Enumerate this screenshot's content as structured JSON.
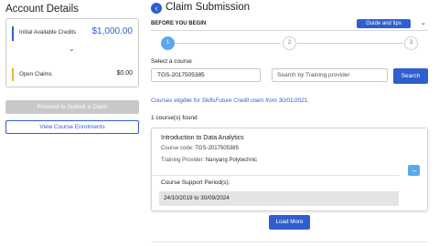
{
  "sidebar": {
    "title": "Account Details",
    "credits": {
      "label": "Initial Available Credits",
      "value": "$1,000.00"
    },
    "claims": {
      "label": "Open Claims",
      "value": "$0.00"
    },
    "proceed_label": "Proceed to Submit a Claim",
    "view_enrolments_label": "View Course Enrolments"
  },
  "header": {
    "back_icon": "chevron-left-icon",
    "title": "Claim Submission",
    "section_label": "BEFORE YOU BEGIN",
    "guide_label": "Guide and tips"
  },
  "stepper": {
    "steps": [
      "1",
      "2",
      "3"
    ],
    "active_step": 1
  },
  "search": {
    "label": "Select a course",
    "course_value": "TGS-2017505385",
    "provider_placeholder": "Search by Training provider",
    "button_label": "Search"
  },
  "results": {
    "eligibility_note": "Courses eligible for SkillsFuture Credit claim from 30/01/2021.",
    "count_text": "1 course(s) found",
    "course": {
      "name": "Introduction to Data Analytics",
      "code_label": "Course code:",
      "code": "TGS-2017505385",
      "provider_label": "Training Provider:",
      "provider": "Nanyang Polytechnic",
      "support_label": "Course Support Period(s):",
      "support_period": "24/10/2019 to 30/09/2024"
    },
    "load_more_label": "Load More"
  },
  "colors": {
    "accent": "#2f5fcf",
    "light_accent": "#5aa9ef",
    "claims_marker": "#e8b23a"
  }
}
